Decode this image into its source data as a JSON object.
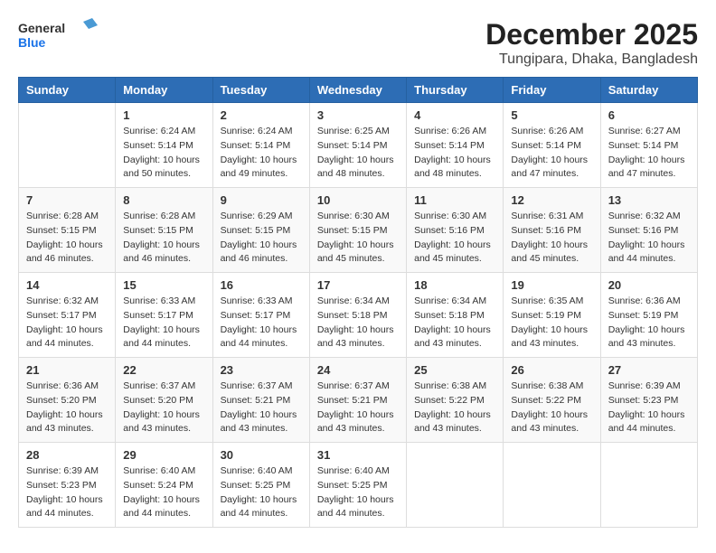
{
  "header": {
    "logo_line1": "General",
    "logo_line2": "Blue",
    "month_year": "December 2025",
    "location": "Tungipara, Dhaka, Bangladesh"
  },
  "days_of_week": [
    "Sunday",
    "Monday",
    "Tuesday",
    "Wednesday",
    "Thursday",
    "Friday",
    "Saturday"
  ],
  "weeks": [
    [
      {
        "day": "",
        "info": ""
      },
      {
        "day": "1",
        "info": "Sunrise: 6:24 AM\nSunset: 5:14 PM\nDaylight: 10 hours\nand 50 minutes."
      },
      {
        "day": "2",
        "info": "Sunrise: 6:24 AM\nSunset: 5:14 PM\nDaylight: 10 hours\nand 49 minutes."
      },
      {
        "day": "3",
        "info": "Sunrise: 6:25 AM\nSunset: 5:14 PM\nDaylight: 10 hours\nand 48 minutes."
      },
      {
        "day": "4",
        "info": "Sunrise: 6:26 AM\nSunset: 5:14 PM\nDaylight: 10 hours\nand 48 minutes."
      },
      {
        "day": "5",
        "info": "Sunrise: 6:26 AM\nSunset: 5:14 PM\nDaylight: 10 hours\nand 47 minutes."
      },
      {
        "day": "6",
        "info": "Sunrise: 6:27 AM\nSunset: 5:14 PM\nDaylight: 10 hours\nand 47 minutes."
      }
    ],
    [
      {
        "day": "7",
        "info": "Sunrise: 6:28 AM\nSunset: 5:15 PM\nDaylight: 10 hours\nand 46 minutes."
      },
      {
        "day": "8",
        "info": "Sunrise: 6:28 AM\nSunset: 5:15 PM\nDaylight: 10 hours\nand 46 minutes."
      },
      {
        "day": "9",
        "info": "Sunrise: 6:29 AM\nSunset: 5:15 PM\nDaylight: 10 hours\nand 46 minutes."
      },
      {
        "day": "10",
        "info": "Sunrise: 6:30 AM\nSunset: 5:15 PM\nDaylight: 10 hours\nand 45 minutes."
      },
      {
        "day": "11",
        "info": "Sunrise: 6:30 AM\nSunset: 5:16 PM\nDaylight: 10 hours\nand 45 minutes."
      },
      {
        "day": "12",
        "info": "Sunrise: 6:31 AM\nSunset: 5:16 PM\nDaylight: 10 hours\nand 45 minutes."
      },
      {
        "day": "13",
        "info": "Sunrise: 6:32 AM\nSunset: 5:16 PM\nDaylight: 10 hours\nand 44 minutes."
      }
    ],
    [
      {
        "day": "14",
        "info": "Sunrise: 6:32 AM\nSunset: 5:17 PM\nDaylight: 10 hours\nand 44 minutes."
      },
      {
        "day": "15",
        "info": "Sunrise: 6:33 AM\nSunset: 5:17 PM\nDaylight: 10 hours\nand 44 minutes."
      },
      {
        "day": "16",
        "info": "Sunrise: 6:33 AM\nSunset: 5:17 PM\nDaylight: 10 hours\nand 44 minutes."
      },
      {
        "day": "17",
        "info": "Sunrise: 6:34 AM\nSunset: 5:18 PM\nDaylight: 10 hours\nand 43 minutes."
      },
      {
        "day": "18",
        "info": "Sunrise: 6:34 AM\nSunset: 5:18 PM\nDaylight: 10 hours\nand 43 minutes."
      },
      {
        "day": "19",
        "info": "Sunrise: 6:35 AM\nSunset: 5:19 PM\nDaylight: 10 hours\nand 43 minutes."
      },
      {
        "day": "20",
        "info": "Sunrise: 6:36 AM\nSunset: 5:19 PM\nDaylight: 10 hours\nand 43 minutes."
      }
    ],
    [
      {
        "day": "21",
        "info": "Sunrise: 6:36 AM\nSunset: 5:20 PM\nDaylight: 10 hours\nand 43 minutes."
      },
      {
        "day": "22",
        "info": "Sunrise: 6:37 AM\nSunset: 5:20 PM\nDaylight: 10 hours\nand 43 minutes."
      },
      {
        "day": "23",
        "info": "Sunrise: 6:37 AM\nSunset: 5:21 PM\nDaylight: 10 hours\nand 43 minutes."
      },
      {
        "day": "24",
        "info": "Sunrise: 6:37 AM\nSunset: 5:21 PM\nDaylight: 10 hours\nand 43 minutes."
      },
      {
        "day": "25",
        "info": "Sunrise: 6:38 AM\nSunset: 5:22 PM\nDaylight: 10 hours\nand 43 minutes."
      },
      {
        "day": "26",
        "info": "Sunrise: 6:38 AM\nSunset: 5:22 PM\nDaylight: 10 hours\nand 43 minutes."
      },
      {
        "day": "27",
        "info": "Sunrise: 6:39 AM\nSunset: 5:23 PM\nDaylight: 10 hours\nand 44 minutes."
      }
    ],
    [
      {
        "day": "28",
        "info": "Sunrise: 6:39 AM\nSunset: 5:23 PM\nDaylight: 10 hours\nand 44 minutes."
      },
      {
        "day": "29",
        "info": "Sunrise: 6:40 AM\nSunset: 5:24 PM\nDaylight: 10 hours\nand 44 minutes."
      },
      {
        "day": "30",
        "info": "Sunrise: 6:40 AM\nSunset: 5:25 PM\nDaylight: 10 hours\nand 44 minutes."
      },
      {
        "day": "31",
        "info": "Sunrise: 6:40 AM\nSunset: 5:25 PM\nDaylight: 10 hours\nand 44 minutes."
      },
      {
        "day": "",
        "info": ""
      },
      {
        "day": "",
        "info": ""
      },
      {
        "day": "",
        "info": ""
      }
    ]
  ]
}
